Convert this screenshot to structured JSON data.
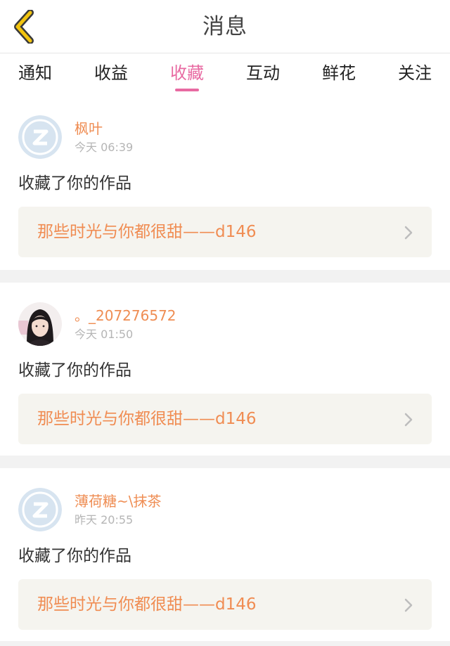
{
  "header": {
    "title": "消息",
    "back_icon": "chevron-left-icon",
    "back_color": "#f2c40f"
  },
  "tabs": [
    {
      "label": "通知",
      "active": false
    },
    {
      "label": "收益",
      "active": false
    },
    {
      "label": "收藏",
      "active": true
    },
    {
      "label": "互动",
      "active": false
    },
    {
      "label": "鲜花",
      "active": false
    },
    {
      "label": "关注",
      "active": false
    }
  ],
  "colors": {
    "accent_pink": "#e86aa2",
    "username_orange": "#ef8d53",
    "link_orange": "#f08c52"
  },
  "messages": [
    {
      "username": "枫叶",
      "time": "今天 06:39",
      "action": "收藏了你的作品",
      "work_title": "那些时光与你都很甜——d146",
      "avatar": "default-avatar-icon"
    },
    {
      "username": "。_207276572",
      "time": "今天 01:50",
      "action": "收藏了你的作品",
      "work_title": "那些时光与你都很甜——d146",
      "avatar": "user-photo-avatar"
    },
    {
      "username": "薄荷糖~\\抹茶",
      "time": "昨天 20:55",
      "action": "收藏了你的作品",
      "work_title": "那些时光与你都很甜——d146",
      "avatar": "default-avatar-icon"
    }
  ]
}
